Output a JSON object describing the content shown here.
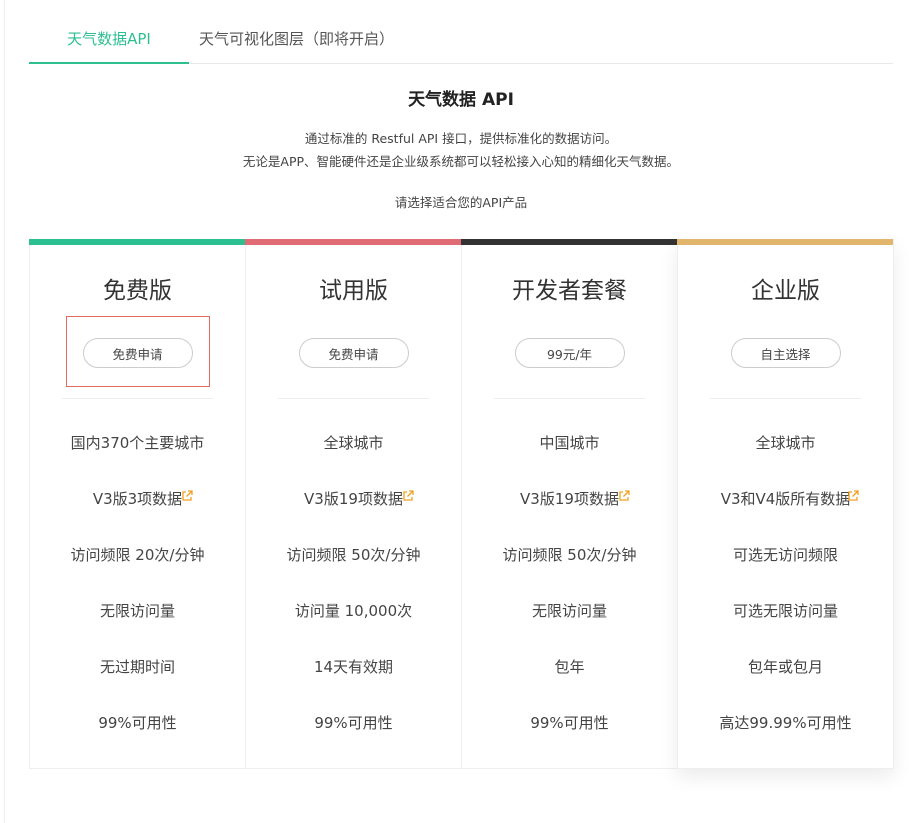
{
  "tabs": [
    {
      "label": "天气数据API",
      "active": true
    },
    {
      "label": "天气可视化图层（即将开启）",
      "active": false
    }
  ],
  "intro": {
    "title": "天气数据 API",
    "description_line1": "通过标准的 Restful API 接口，提供标准化的数据访问。",
    "description_line2": "无论是APP、智能硬件还是企业级系统都可以轻松接入心知的精细化天气数据。",
    "choose_text": "请选择适合您的API产品"
  },
  "colors": {
    "accent": "#2ebf91",
    "free_bar": "#2ebf91",
    "trial_bar": "#e06b74",
    "developer_bar": "#333333",
    "enterprise_bar": "#e1b56b",
    "highlight_border": "#e46a5e",
    "link_icon": "#f0a020"
  },
  "plans": [
    {
      "title": "免费版",
      "button": "免费申请",
      "features": [
        "国内370个主要城市",
        "V3版3项数据",
        "访问频限 20次/分钟",
        "无限访问量",
        "无过期时间",
        "99%可用性"
      ]
    },
    {
      "title": "试用版",
      "button": "免费申请",
      "features": [
        "全球城市",
        "V3版19项数据",
        "访问频限 50次/分钟",
        "访问量 10,000次",
        "14天有效期",
        "99%可用性"
      ]
    },
    {
      "title": "开发者套餐",
      "button": "99元/年",
      "features": [
        "中国城市",
        "V3版19项数据",
        "访问频限 50次/分钟",
        "无限访问量",
        "包年",
        "99%可用性"
      ]
    },
    {
      "title": "企业版",
      "button": "自主选择",
      "features": [
        "全球城市",
        "V3和V4版所有数据",
        "可选无访问频限",
        "可选无限访问量",
        "包年或包月",
        "高达99.99%可用性"
      ]
    }
  ],
  "icons": {
    "data_link": "external-link-icon"
  }
}
